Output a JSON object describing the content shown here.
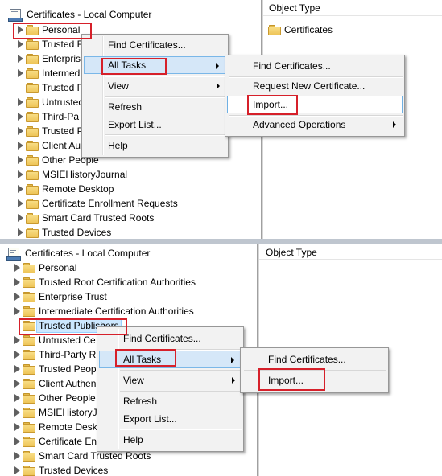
{
  "top": {
    "root_label": "Certificates - Local Computer",
    "tree_items": [
      "Personal",
      "Trusted R",
      "Enterprise",
      "Intermed",
      "Trusted P",
      "Untrusted",
      "Third-Pa",
      "Trusted P",
      "Client Au",
      "Other People",
      "MSIEHistoryJournal",
      "Remote Desktop",
      "Certificate Enrollment Requests",
      "Smart Card Trusted Roots",
      "Trusted Devices"
    ],
    "detail_header": "Object Type",
    "detail_item": "Certificates",
    "context_menu": {
      "find_certificates": "Find Certificates...",
      "all_tasks": "All Tasks",
      "view": "View",
      "refresh": "Refresh",
      "export_list": "Export List...",
      "help": "Help"
    },
    "submenu": {
      "find_certificates": "Find Certificates...",
      "request_new_certificate": "Request New Certificate...",
      "import": "Import...",
      "advanced_operations": "Advanced Operations"
    }
  },
  "bottom": {
    "root_label": "Certificates - Local Computer",
    "tree_items": [
      "Personal",
      "Trusted Root Certification Authorities",
      "Enterprise Trust",
      "Intermediate Certification Authorities",
      "Trusted Publishers",
      "Untrusted Ce",
      "Third-Party R",
      "Trusted Peop",
      "Client Authen",
      "Other People",
      "MSIEHistoryJ",
      "Remote Desk",
      "Certificate En",
      "Smart Card Trusted Roots",
      "Trusted Devices"
    ],
    "detail_header": "Object Type",
    "context_menu": {
      "find_certificates": "Find Certificates...",
      "all_tasks": "All Tasks",
      "view": "View",
      "refresh": "Refresh",
      "export_list": "Export List...",
      "help": "Help"
    },
    "submenu": {
      "find_certificates": "Find Certificates...",
      "import": "Import..."
    }
  },
  "colors": {
    "highlight_box": "#d6202a",
    "menu_hover": "#d5e7f8",
    "folder": "#eec559"
  },
  "icons": [
    "certificate-store-icon",
    "folder-icon",
    "expand-arrow-icon",
    "submenu-arrow-icon"
  ]
}
